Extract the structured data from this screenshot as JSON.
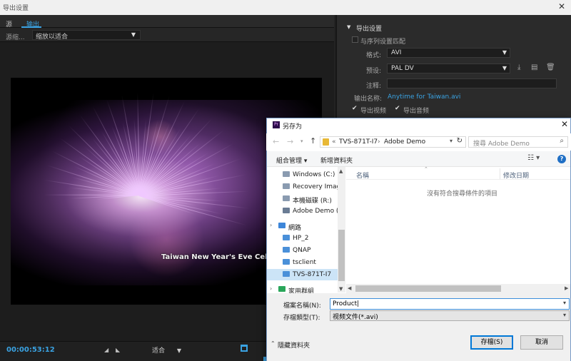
{
  "window": {
    "title": "导出设置",
    "close_glyph": "✕"
  },
  "left": {
    "tabs": [
      "源",
      "输出"
    ],
    "source_scale_label": "源缩...",
    "scale_value": "缩放以适合",
    "video_caption": "Taiwan New Year's Eve Celel",
    "timecode": "00:00:53:12",
    "fit_value": "适合"
  },
  "right": {
    "section_title": "导出设置",
    "match_sequence": "与序列设置匹配",
    "format_label": "格式:",
    "format_value": "AVI",
    "preset_label": "预设:",
    "preset_value": "PAL DV",
    "comment_label": "注释:",
    "output_name_label": "输出名称:",
    "output_name_value": "Anytime for Taiwan.avi",
    "export_video": "导出视频",
    "export_audio": "导出音频"
  },
  "dialog": {
    "title": "另存为",
    "logo_text": "Pr",
    "path": [
      "TVS-871T-I7",
      "Adobe Demo"
    ],
    "search_placeholder": "搜尋 Adobe Demo",
    "organize": "組合管理 ▾",
    "new_folder": "新增資料夾",
    "nav_items": [
      {
        "label": "Windows (C:)",
        "icon": "drive-icon"
      },
      {
        "label": "Recovery Image",
        "icon": "drive-icon"
      },
      {
        "label": "本機磁碟 (R:)",
        "icon": "drive-icon"
      },
      {
        "label": "Adobe Demo (\\",
        "icon": "network-drive-icon"
      },
      {
        "label": "網路",
        "icon": "network-icon"
      },
      {
        "label": "HP_2",
        "icon": "computer-icon"
      },
      {
        "label": "QNAP",
        "icon": "computer-icon"
      },
      {
        "label": "tsclient",
        "icon": "computer-icon"
      },
      {
        "label": "TVS-871T-I7",
        "icon": "computer-icon"
      },
      {
        "label": "家用群組",
        "icon": "homegroup-icon"
      }
    ],
    "col_name": "名稱",
    "col_date": "修改日期",
    "empty_message": "沒有符合搜尋條件的項目",
    "filename_label": "檔案名稱(N):",
    "filename_value": "Product",
    "filetype_label": "存檔類型(T):",
    "filetype_value": "视频文件(*.avi)",
    "hide_folders": "隱藏資料夾",
    "save_button": "存檔(S)",
    "cancel_button": "取消"
  },
  "colors": {
    "accent_blue": "#3aa3e3",
    "dialog_border": "#7a9cc7",
    "win_primary": "#0078d7"
  }
}
